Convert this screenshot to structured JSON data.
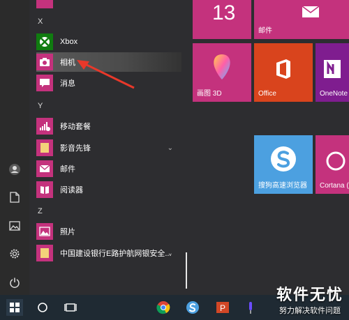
{
  "sections": {
    "x": "X",
    "y": "Y",
    "z": "Z"
  },
  "apps": {
    "xbox": "Xbox",
    "camera": "相机",
    "messages": "消息",
    "mobile": "移动套餐",
    "film": "影音先锋",
    "mail": "邮件",
    "reader": "阅读器",
    "photos": "照片",
    "ccb": "中国建设银行E路护航网银安全..."
  },
  "tiles": {
    "calendar_day": "13",
    "mail": "邮件",
    "paint3d": "画图 3D",
    "office": "Office",
    "onenote": "OneNote",
    "sogou": "搜狗高速浏览器",
    "cortana": "Cortana (小娜)",
    "top_partial": "邮件"
  },
  "colors": {
    "accent_pink": "#c4327d",
    "office_orange": "#d9441d",
    "onenote_purple": "#7f1d8f",
    "sogou_blue": "#4ca0e0"
  },
  "watermark": {
    "title": "软件无忧",
    "subtitle": "努力解决软件问题"
  }
}
